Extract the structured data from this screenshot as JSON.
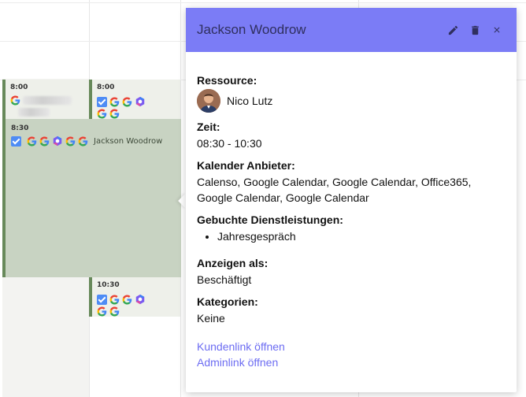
{
  "calendar": {
    "events": [
      {
        "time": "8:00"
      },
      {
        "time": "8:00"
      },
      {
        "time": "8:30",
        "title": "Jackson Woodrow"
      },
      {
        "time": "10:30"
      }
    ]
  },
  "popover": {
    "title": "Jackson Woodrow",
    "header_color": "#7b7cf6",
    "actions": [
      "pencil-icon",
      "trash-icon",
      "close-icon"
    ],
    "resource_label": "Ressource:",
    "resource_name": "Nico Lutz",
    "time_label": "Zeit:",
    "time_value": "08:30 - 10:30",
    "provider_label": "Kalender Anbieter:",
    "provider_value": "Calenso, Google Calendar, Google Calendar, Office365, Google Calendar, Google Calendar",
    "services_label": "Gebuchte Dienstleistungen:",
    "services": [
      "Jahresgespräch"
    ],
    "show_as_label": "Anzeigen als:",
    "show_as_value": "Beschäftigt",
    "categories_label": "Kategorien:",
    "categories_value": "Keine",
    "customer_link": "Kundenlink öffnen",
    "admin_link": "Adminlink öffnen",
    "link_color": "#6c6cf2"
  }
}
